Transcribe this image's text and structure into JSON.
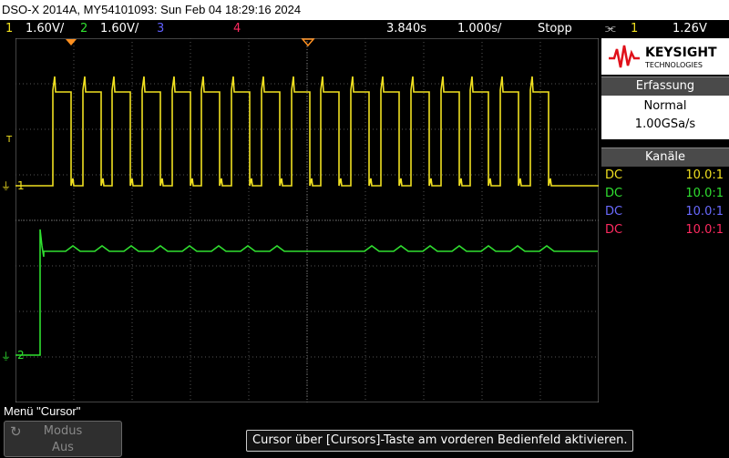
{
  "title": "DSO-X 2014A, MY54101093: Sun Feb 04 18:29:16 2024",
  "status": {
    "ch1_num": "1",
    "ch1_scale": "1.60V/",
    "ch2_num": "2",
    "ch2_scale": "1.60V/",
    "ch3_num": "3",
    "ch4_num": "4",
    "time_offset": "3.840s",
    "time_scale": "1.000s/",
    "run_state": "Stopp",
    "trig_symbol": "⫘",
    "trig_src": "1",
    "trig_level": "1.26V"
  },
  "colors": {
    "ch1": "#f0e020",
    "ch2": "#30e030",
    "ch3": "#6060ff",
    "ch4": "#ff2a60",
    "trig": "#ff9020"
  },
  "markers": {
    "trigger_label": "T",
    "ch1_marker": "1",
    "ch2_marker": "2"
  },
  "logo": {
    "brand": "KEYSIGHT",
    "sub": "TECHNOLOGIES"
  },
  "acquisition": {
    "header": "Erfassung",
    "mode": "Normal",
    "rate": "1.00GSa/s"
  },
  "channels": {
    "header": "Kanäle",
    "rows": [
      {
        "coupling": "DC",
        "ratio": "10.0:1"
      },
      {
        "coupling": "DC",
        "ratio": "10.0:1"
      },
      {
        "coupling": "DC",
        "ratio": "10.0:1"
      },
      {
        "coupling": "DC",
        "ratio": "10.0:1"
      }
    ]
  },
  "menu": {
    "label": "Menü \"Cursor\"",
    "mode_label": "Modus",
    "mode_value": "Aus"
  },
  "hint": "Cursor über [Cursors]-Taste am vorderen Bedienfeld aktivieren."
}
